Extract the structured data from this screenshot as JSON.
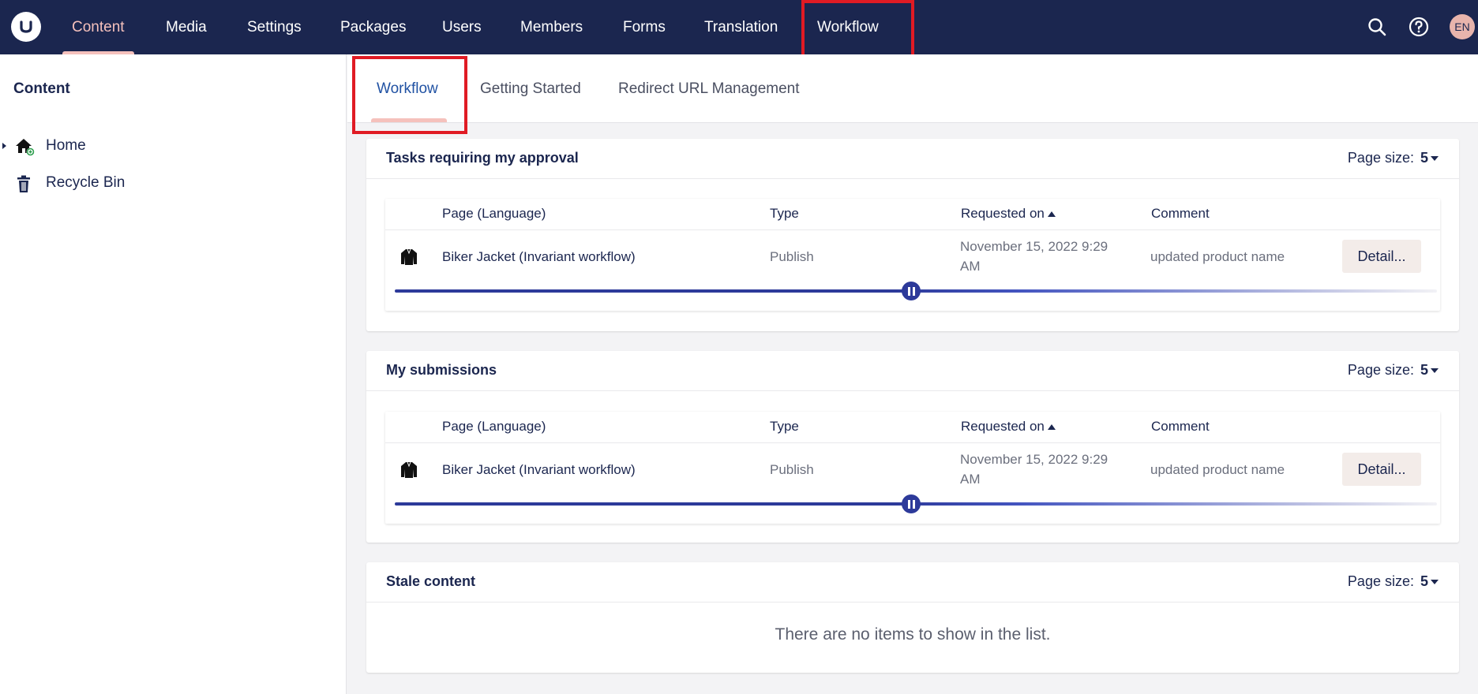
{
  "nav": {
    "items": [
      {
        "label": "Content",
        "active": true
      },
      {
        "label": "Media"
      },
      {
        "label": "Settings"
      },
      {
        "label": "Packages"
      },
      {
        "label": "Users"
      },
      {
        "label": "Members"
      },
      {
        "label": "Forms"
      },
      {
        "label": "Translation"
      },
      {
        "label": "Workflow"
      }
    ],
    "user_initials": "EN"
  },
  "sidebar": {
    "title": "Content",
    "items": [
      {
        "label": "Home",
        "icon": "home-icon"
      },
      {
        "label": "Recycle Bin",
        "icon": "trash-icon"
      }
    ]
  },
  "subtabs": [
    {
      "label": "Workflow",
      "active": true
    },
    {
      "label": "Getting Started"
    },
    {
      "label": "Redirect URL Management"
    }
  ],
  "panels": {
    "approval": {
      "title": "Tasks requiring my approval",
      "page_size_label": "Page size:",
      "page_size_value": "5",
      "headers": {
        "page": "Page (Language)",
        "type": "Type",
        "requested": "Requested on",
        "comment": "Comment"
      },
      "row": {
        "page": "Biker Jacket (Invariant workflow)",
        "type": "Publish",
        "date": "November 15, 2022 9:29 AM",
        "comment": "updated product name",
        "action": "Detail..."
      }
    },
    "submissions": {
      "title": "My submissions",
      "page_size_label": "Page size:",
      "page_size_value": "5",
      "headers": {
        "page": "Page (Language)",
        "type": "Type",
        "requested": "Requested on",
        "comment": "Comment"
      },
      "row": {
        "page": "Biker Jacket (Invariant workflow)",
        "type": "Publish",
        "date": "November 15, 2022 9:29 AM",
        "comment": "updated product name",
        "action": "Detail..."
      }
    },
    "stale": {
      "title": "Stale content",
      "page_size_label": "Page size:",
      "page_size_value": "5",
      "empty_message": "There are no items to show in the list."
    }
  },
  "colors": {
    "topbar": "#1b264f",
    "accent_pink": "#f5c1bc",
    "highlight_red": "#e01b24",
    "progress_blue": "#2d3a9a"
  }
}
